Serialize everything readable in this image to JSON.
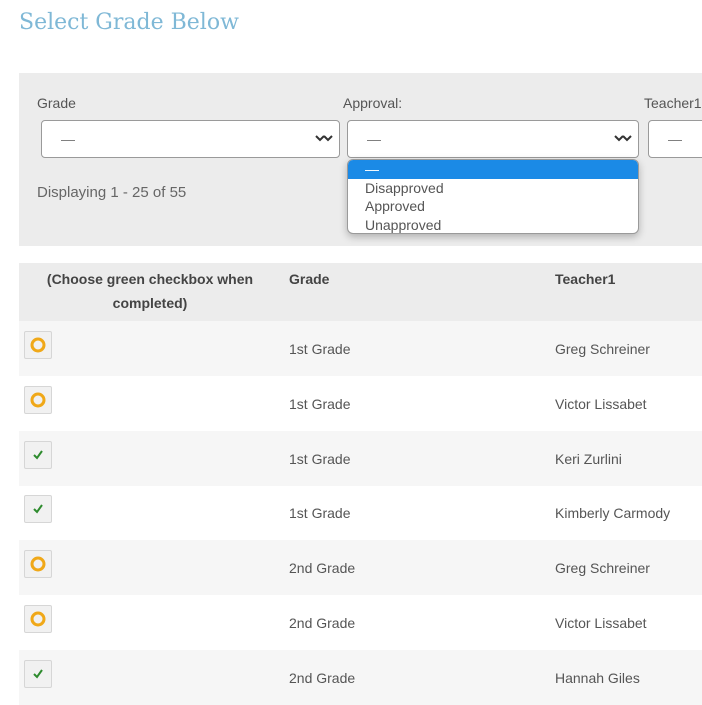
{
  "page": {
    "title": "Select Grade Below"
  },
  "filters": {
    "grade": {
      "label": "Grade",
      "value": "—"
    },
    "approval": {
      "label": "Approval:",
      "value": "—"
    },
    "teacher1": {
      "label": "Teacher1",
      "value": "—"
    },
    "approval_dropdown": {
      "options": [
        "—",
        "Disapproved",
        "Approved",
        "Unapproved"
      ],
      "selected_index": 0
    },
    "displaying_text": "Displaying 1 - 25 of 55"
  },
  "table": {
    "columns": [
      "(Choose green checkbox when completed)",
      "Grade",
      "Teacher1"
    ],
    "rows": [
      {
        "status": "pending",
        "status_icon": "circle-icon",
        "grade": "1st Grade",
        "teacher1": "Greg Schreiner"
      },
      {
        "status": "pending",
        "status_icon": "circle-icon",
        "grade": "1st Grade",
        "teacher1": "Victor Lissabet"
      },
      {
        "status": "completed",
        "status_icon": "check-icon",
        "grade": "1st Grade",
        "teacher1": "Keri Zurlini"
      },
      {
        "status": "completed",
        "status_icon": "check-icon",
        "grade": "1st Grade",
        "teacher1": "Kimberly Carmody"
      },
      {
        "status": "pending",
        "status_icon": "circle-icon",
        "grade": "2nd Grade",
        "teacher1": "Greg Schreiner"
      },
      {
        "status": "pending",
        "status_icon": "circle-icon",
        "grade": "2nd Grade",
        "teacher1": "Victor Lissabet"
      },
      {
        "status": "completed",
        "status_icon": "check-icon",
        "grade": "2nd Grade",
        "teacher1": "Hannah Giles"
      }
    ]
  },
  "colors": {
    "title": "#7fb8d6",
    "pending_circle": "#f0a818",
    "completed_check": "#2e8b2e",
    "dropdown_selected": "#1b8ae6"
  }
}
